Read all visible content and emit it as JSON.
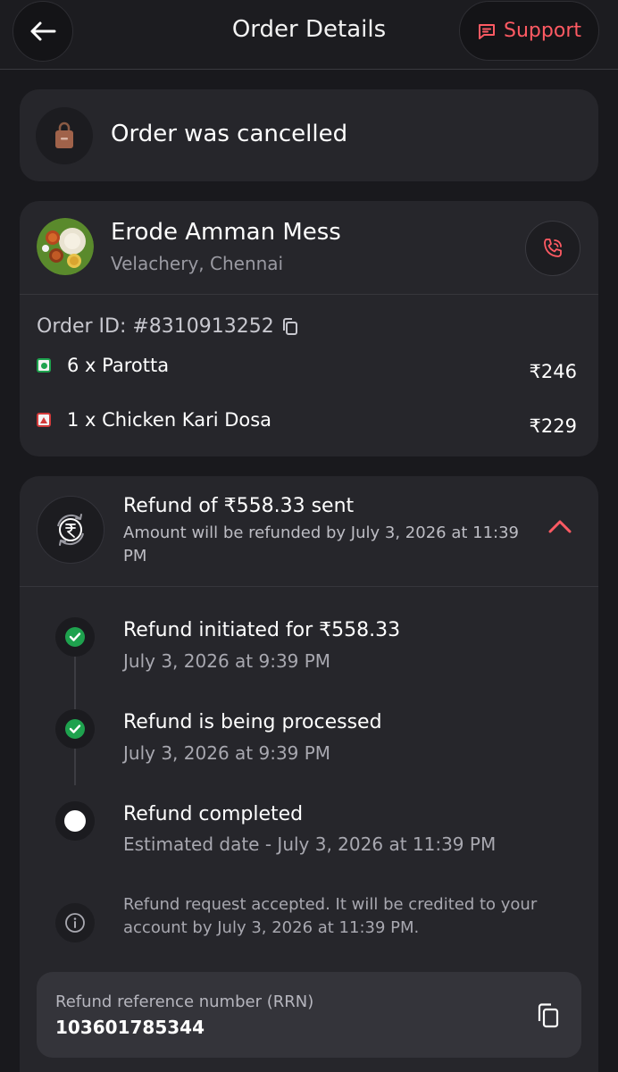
{
  "header": {
    "title": "Order Details",
    "support_label": "Support"
  },
  "status": {
    "text": "Order was cancelled"
  },
  "restaurant": {
    "name": "Erode Amman Mess",
    "location": "Velachery, Chennai",
    "order_id": "Order ID: #8310913252",
    "items": [
      {
        "type": "veg",
        "name": "6 x Parotta",
        "price": "₹246"
      },
      {
        "type": "non-veg",
        "name": "1 x Chicken Kari Dosa",
        "price": "₹229"
      }
    ]
  },
  "refund": {
    "title": "Refund of ₹558.33 sent",
    "subtitle": "Amount will be refunded by July 3, 2026 at 11:39 PM",
    "steps": [
      {
        "title": "Refund initiated for ₹558.33",
        "date": "July 3, 2026 at 9:39 PM",
        "done": true
      },
      {
        "title": "Refund is being processed",
        "date": "July 3, 2026 at 9:39 PM",
        "done": true
      },
      {
        "title": "Refund completed",
        "date": "Estimated date - July 3, 2026 at 11:39 PM",
        "done": false
      }
    ],
    "info": "Refund request accepted. It will be credited to your account by July 3, 2026 at 11:39 PM.",
    "rrn_label": "Refund reference number (RRN)",
    "rrn_value": "103601785344"
  },
  "colors": {
    "accent": "#ff5a63",
    "success": "#1ea24e",
    "background": "#19191d",
    "card": "#26262b"
  }
}
